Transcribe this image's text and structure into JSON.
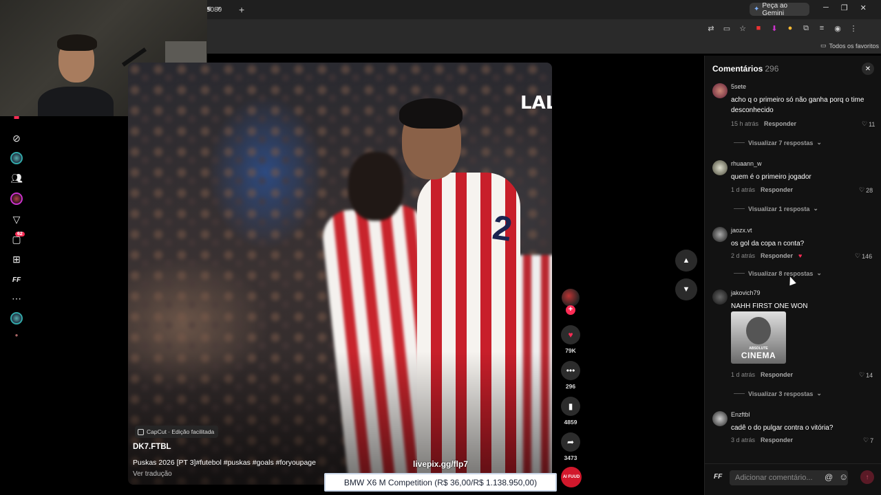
{
  "browser": {
    "url": "5080",
    "gemini_label": "Peça ao Gemini",
    "bookmarks_all": "Todos os favoritos",
    "new_tab": "+",
    "tab_close": "×"
  },
  "leftnav": {
    "messages_badge": "62"
  },
  "video": {
    "overlay_text": "LAL",
    "capcut_label": "CapCut · Edição facilitada",
    "author": "DK7.FTBL",
    "caption": "Puskas 2026 [PT 3]#futebol #puskas #goals #foryoupage",
    "translate_label": "Ver tradução",
    "jersey_number": "2",
    "progress": 0.3
  },
  "actions": {
    "likes": "79K",
    "comments": "296",
    "saves": "4859",
    "shares": "3473",
    "disc_label": "AI FUUD"
  },
  "stream": {
    "livepix": "livepix.gg/flp7",
    "ticker": "BMW X6 M Competition (R$ 36,00/R$ 1.138.950,00)"
  },
  "comments_panel": {
    "title": "Comentários",
    "count": "296",
    "input_placeholder": "Adicionar comentário...",
    "input_logo": "FF",
    "items": [
      {
        "user": "5sete",
        "text": "acho q o primeiro só não ganha porq o time desconhecido",
        "time": "15 h atrás",
        "reply": "Responder",
        "likes": "11",
        "view": "Visualizar 7 respostas"
      },
      {
        "user": "rhuaann_w",
        "text": "quem é o primeiro jogador",
        "time": "1 d atrás",
        "reply": "Responder",
        "likes": "28",
        "view": "Visualizar 1 resposta"
      },
      {
        "user": "jaozx.vt",
        "text": "os gol da copa n conta?",
        "time": "2 d atrás",
        "reply": "Responder",
        "likes": "146",
        "view": "Visualizar 8 respostas"
      },
      {
        "user": "jakovich79",
        "text": "NAHH FIRST ONE WON",
        "time": "1 d atrás",
        "reply": "Responder",
        "likes": "14",
        "view": "Visualizar 3 respostas",
        "sticker_small": "ABSOLUTE",
        "sticker_big": "CINEMA"
      },
      {
        "user": "Enzftbl",
        "text": "cadê o do pulgar contra o vitória?",
        "time": "3 d atrás",
        "reply": "Responder",
        "likes": "7"
      }
    ]
  },
  "colors": {
    "accent": "#fe2c55",
    "panel_bg": "#121212",
    "jersey_red": "#c8242c"
  }
}
